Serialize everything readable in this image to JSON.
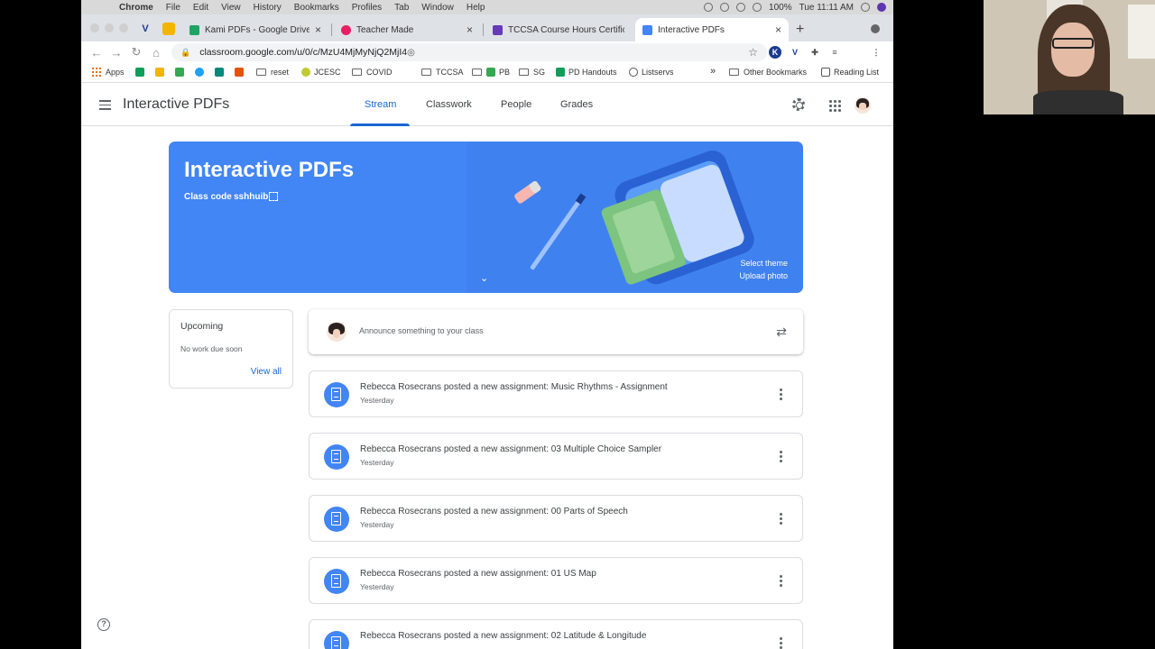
{
  "menubar": {
    "items": [
      "Chrome",
      "File",
      "Edit",
      "View",
      "History",
      "Bookmarks",
      "Profiles",
      "Tab",
      "Window",
      "Help"
    ],
    "battery": "100%",
    "clock": "Tue 11:11 AM"
  },
  "tabs": [
    {
      "label": "Kami PDFs - Google Drive",
      "color": "#1fa463"
    },
    {
      "label": "Teacher Made",
      "color": "#e91e63"
    },
    {
      "label": "TCCSA Course Hours Certifica",
      "color": "#673ab7"
    },
    {
      "label": "Interactive PDFs",
      "color": "#4285f4",
      "active": true
    }
  ],
  "url": "classroom.google.com/u/0/c/MzU4MjMyNjQ2MjI4",
  "bookmarks": [
    {
      "label": "Apps",
      "kind": "grid"
    },
    {
      "label": "",
      "kind": "icon",
      "color": "#0f9d58"
    },
    {
      "label": "",
      "kind": "icon",
      "color": "#f4b400"
    },
    {
      "label": "",
      "kind": "icon",
      "color": "#34a853"
    },
    {
      "label": "",
      "kind": "icon",
      "color": "#1da1f2"
    },
    {
      "label": "",
      "kind": "icon",
      "color": "#00897b"
    },
    {
      "label": "",
      "kind": "icon",
      "color": "#e65100"
    },
    {
      "label": "reset",
      "kind": "folder"
    },
    {
      "label": "JCESC",
      "kind": "icon",
      "color": "#c0ca33"
    },
    {
      "label": "COVID",
      "kind": "folder"
    },
    {
      "label": "TCCSA",
      "kind": "folder"
    },
    {
      "label": "PB",
      "kind": "folder"
    },
    {
      "label": "SG",
      "kind": "folder"
    },
    {
      "label": "PD Handouts",
      "kind": "icon",
      "color": "#0f9d58"
    },
    {
      "label": "Listservs",
      "kind": "icon",
      "color": "#555555"
    }
  ],
  "bookmarks_right": {
    "more": "»",
    "other": "Other Bookmarks",
    "reading": "Reading List"
  },
  "classroom": {
    "title": "Interactive PDFs",
    "nav": [
      "Stream",
      "Classwork",
      "People",
      "Grades"
    ]
  },
  "banner": {
    "title": "Interactive PDFs",
    "class_code_label": "Class code",
    "class_code": "sshhuib",
    "select_theme": "Select theme",
    "upload_photo": "Upload photo"
  },
  "upcoming": {
    "title": "Upcoming",
    "empty": "No work due soon",
    "view_all": "View all"
  },
  "announce": {
    "placeholder": "Announce something to your class"
  },
  "posts": [
    {
      "text": "Rebecca Rosecrans posted a new assignment: Music Rhythms - Assignment",
      "date": "Yesterday"
    },
    {
      "text": "Rebecca Rosecrans posted a new assignment: 03 Multiple Choice Sampler",
      "date": "Yesterday"
    },
    {
      "text": "Rebecca Rosecrans posted a new assignment: 00 Parts of Speech",
      "date": "Yesterday"
    },
    {
      "text": "Rebecca Rosecrans posted a new assignment: 01 US Map",
      "date": "Yesterday"
    },
    {
      "text": "Rebecca Rosecrans posted a new assignment: 02 Latitude & Longitude",
      "date": ""
    }
  ],
  "colors": {
    "accent": "#1967d2",
    "banner": "#4285f4"
  }
}
